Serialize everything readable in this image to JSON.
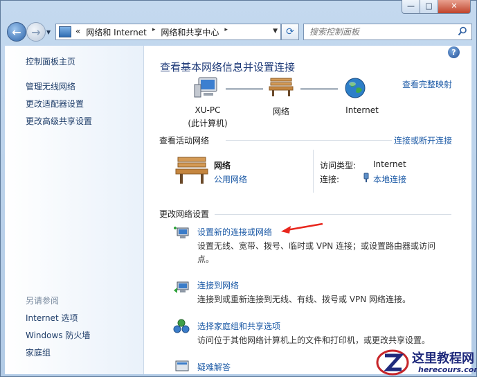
{
  "window": {
    "min_glyph": "—",
    "max_glyph": "□",
    "close_glyph": "✕"
  },
  "nav": {
    "breadcrumb_sep": "«",
    "breadcrumb": [
      "网络和 Internet",
      "网络和共享中心"
    ],
    "search_placeholder": "搜索控制面板"
  },
  "sidebar": {
    "home": "控制面板主页",
    "items": [
      "管理无线网络",
      "更改适配器设置",
      "更改高级共享设置"
    ],
    "see_also_title": "另请参阅",
    "see_also": [
      "Internet 选项",
      "Windows 防火墙",
      "家庭组"
    ]
  },
  "main": {
    "title": "查看基本网络信息并设置连接",
    "view_full_map": "查看完整映射",
    "map": {
      "computer_name": "XU-PC",
      "computer_sub": "(此计算机)",
      "network": "网络",
      "internet": "Internet"
    },
    "active": {
      "title": "查看活动网络",
      "connect_link": "连接或断开连接",
      "network_name": "网络",
      "network_type": "公用网络",
      "access_label": "访问类型:",
      "access_value": "Internet",
      "conn_label": "连接:",
      "conn_value": "本地连接"
    },
    "change": {
      "title": "更改网络设置",
      "tasks": [
        {
          "link": "设置新的连接或网络",
          "desc": "设置无线、宽带、拨号、临时或 VPN 连接；或设置路由器或访问点。"
        },
        {
          "link": "连接到网络",
          "desc": "连接到或重新连接到无线、有线、拨号或 VPN 网络连接。"
        },
        {
          "link": "选择家庭组和共享选项",
          "desc": "访问位于其他网络计算机上的文件和打印机，或更改共享设置。"
        },
        {
          "link": "疑难解答",
          "desc": ""
        }
      ]
    }
  },
  "watermark": {
    "title": "这里教程网",
    "subtitle": "herecours.com"
  },
  "colors": {
    "link": "#1c5aa6",
    "title": "#1e3a78",
    "annotation_arrow": "#e8261d"
  }
}
